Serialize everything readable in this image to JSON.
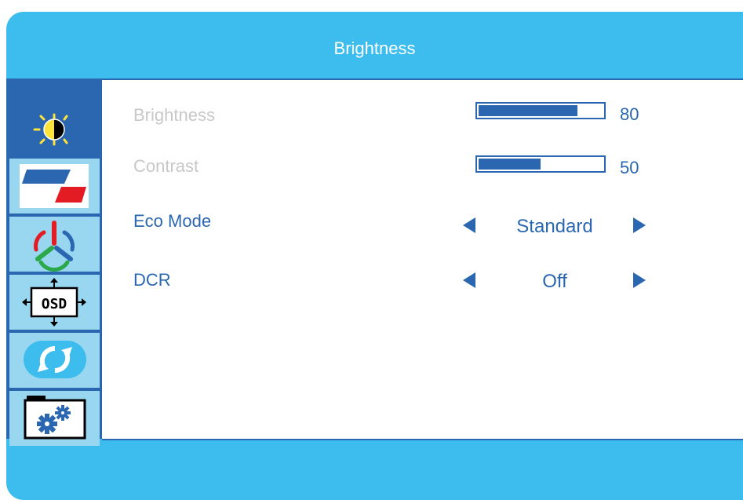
{
  "window": {
    "title": "Brightness"
  },
  "sidebar": {
    "items": [
      {
        "icon": "brightness-icon",
        "active": true
      },
      {
        "icon": "picture-icon",
        "active": false
      },
      {
        "icon": "color-icon",
        "active": false
      },
      {
        "icon": "osd-setup-icon",
        "active": false
      },
      {
        "icon": "reset-icon",
        "active": false
      },
      {
        "icon": "extra-settings-icon",
        "active": false
      }
    ]
  },
  "settings": {
    "brightness": {
      "label": "Brightness",
      "value": "80",
      "level": 80
    },
    "contrast": {
      "label": "Contrast",
      "value": "50",
      "level": 50
    },
    "eco_mode": {
      "label": "Eco Mode",
      "value": "Standard"
    },
    "dcr": {
      "label": "DCR",
      "value": "Off"
    }
  },
  "colors": {
    "frame": "#3dbdee",
    "accent": "#2a67b0",
    "inactive_tile": "#99d6f0",
    "dim_text": "#c8c8c8"
  }
}
